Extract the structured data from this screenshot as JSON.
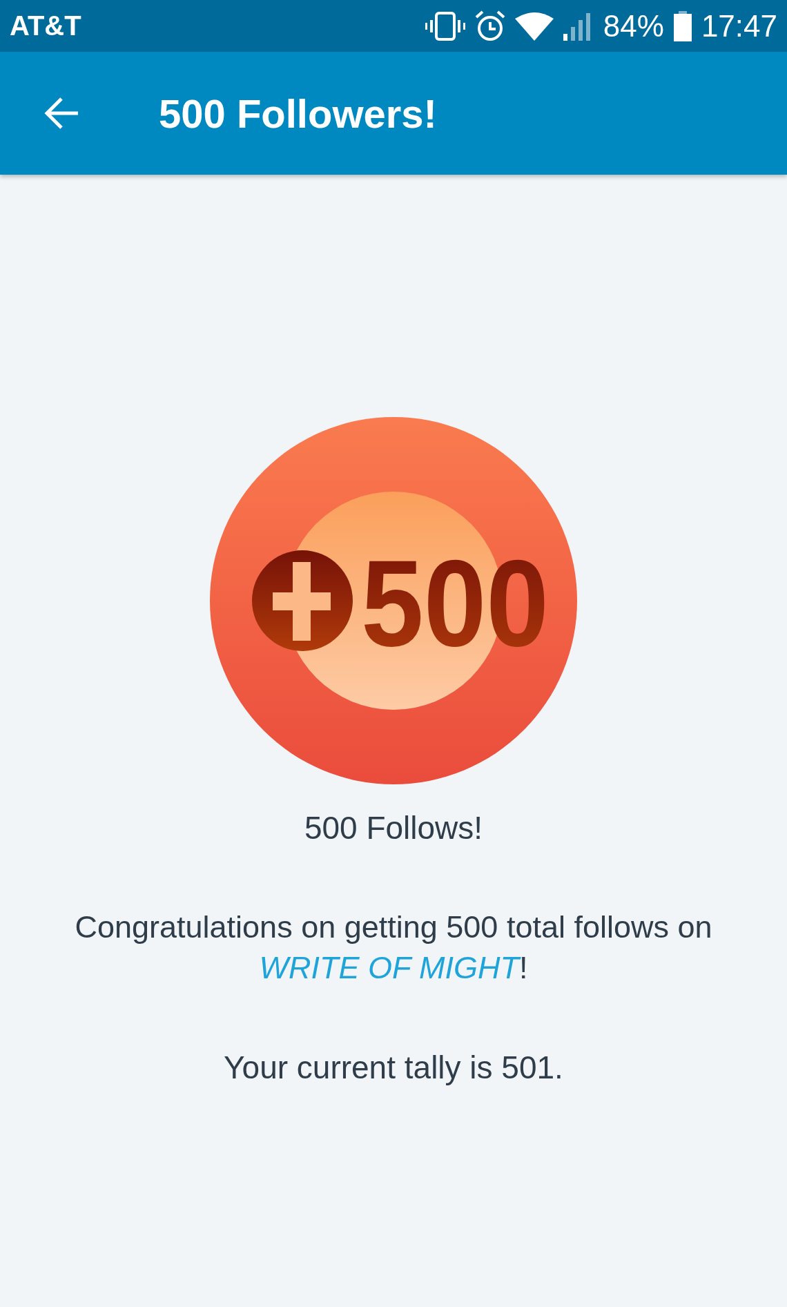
{
  "status_bar": {
    "carrier": "AT&T",
    "battery_percent": "84%",
    "time": "17:47"
  },
  "app_bar": {
    "title": "500 Followers!"
  },
  "badge": {
    "number": "500"
  },
  "achievement": {
    "title": "500 Follows!",
    "message_before": "Congratulations on getting 500 total follows on ",
    "link": "WRITE OF MIGHT",
    "message_after": "!",
    "tally": "Your current tally is 501."
  }
}
